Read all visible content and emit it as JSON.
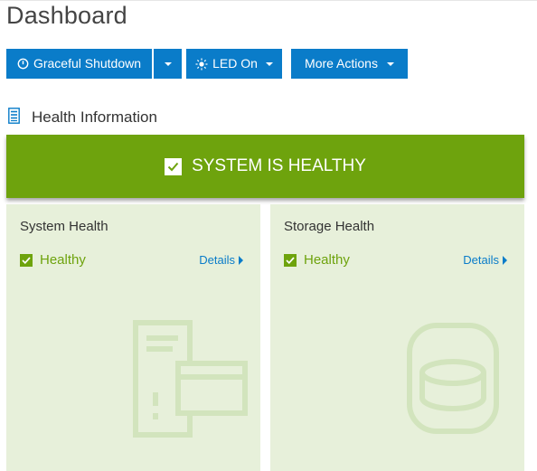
{
  "page": {
    "title": "Dashboard"
  },
  "toolbar": {
    "shutdown_label": "Graceful Shutdown",
    "led_label": "LED On",
    "more_label": "More Actions"
  },
  "health": {
    "section_label": "Health Information",
    "banner_text": "SYSTEM IS HEALTHY",
    "system": {
      "title": "System Health",
      "status": "Healthy",
      "details": "Details"
    },
    "storage": {
      "title": "Storage Health",
      "status": "Healthy",
      "details": "Details"
    }
  },
  "colors": {
    "accent": "#0a7cc9",
    "healthy": "#6ea30d",
    "card_bg": "#e7f0da"
  },
  "icons": [
    "power-icon",
    "chevron-down-icon",
    "led-icon",
    "server-list-icon",
    "check-icon",
    "caret-right-icon",
    "server-icon",
    "storage-icon"
  ]
}
